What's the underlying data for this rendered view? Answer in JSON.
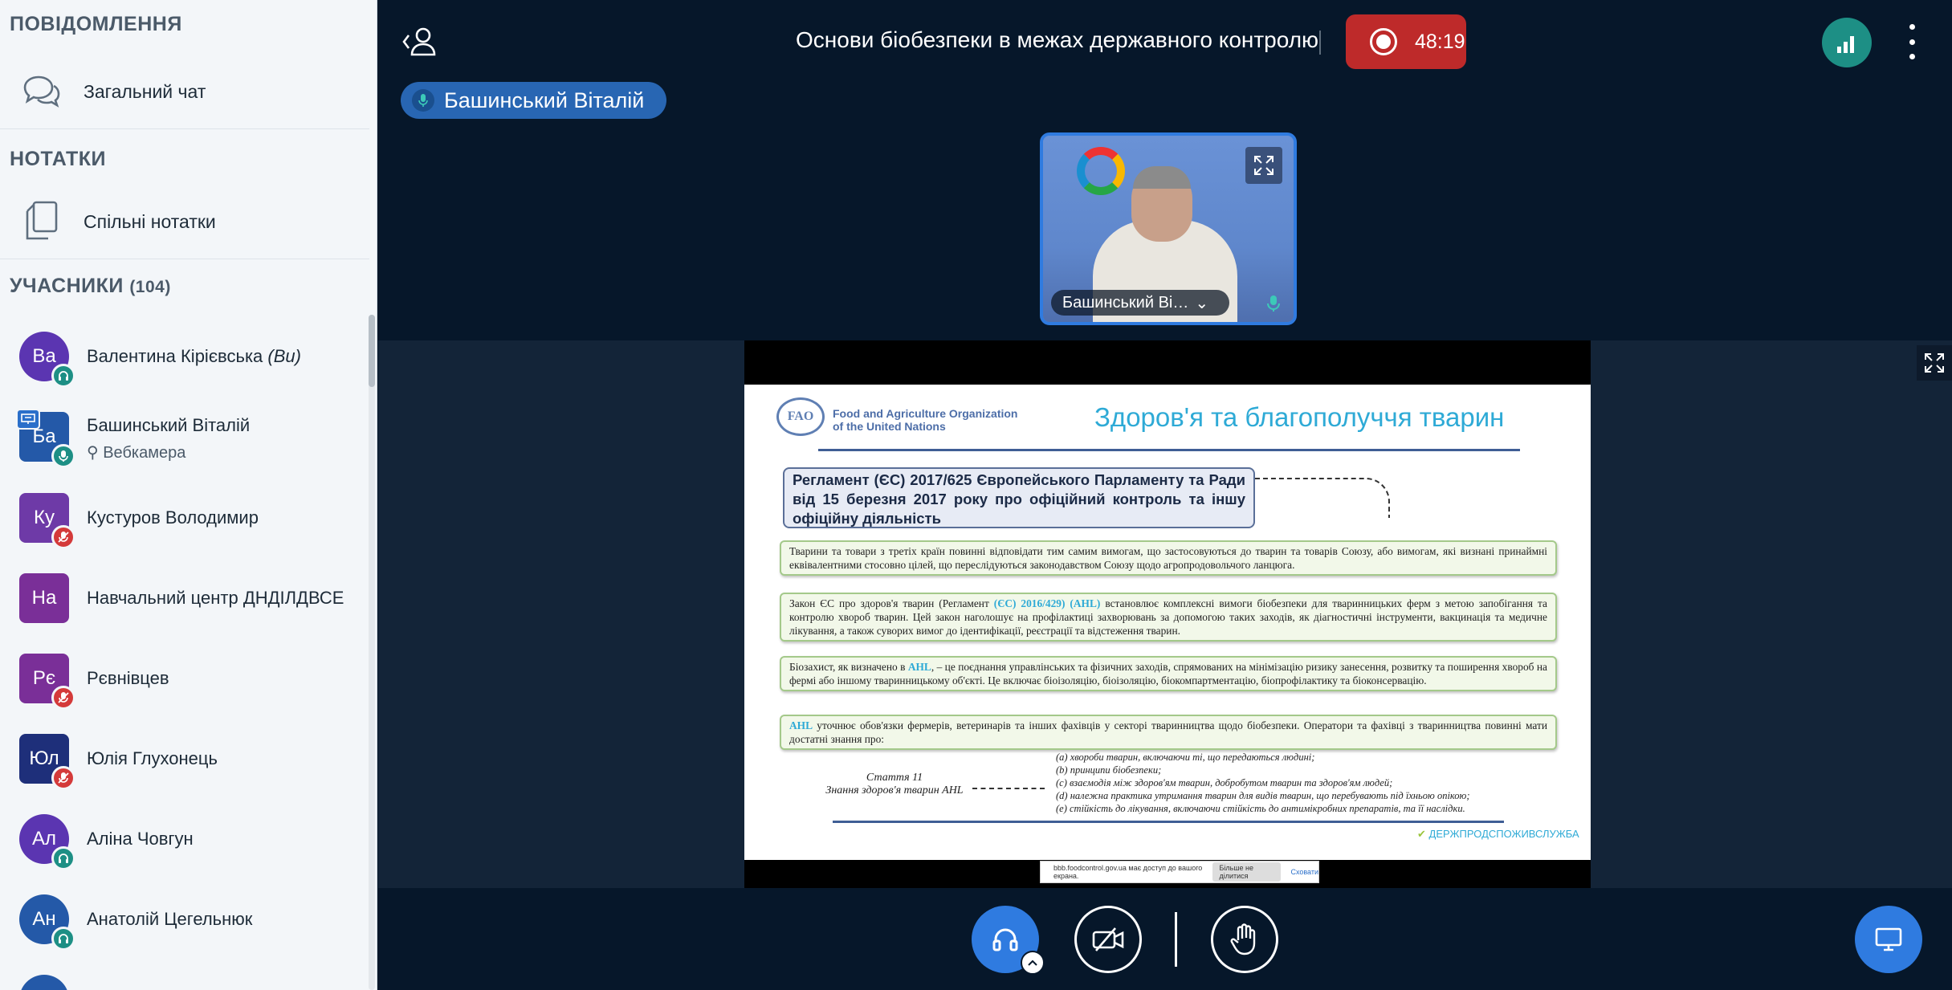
{
  "sidebar": {
    "messages_title": "ПОВІДОМЛЕННЯ",
    "public_chat": "Загальний чат",
    "notes_title": "НОТАТКИ",
    "shared_notes": "Спільні нотатки",
    "participants_title": "УЧАСНИКИ",
    "participants_count": "(104)",
    "users": [
      {
        "initials": "Ва",
        "name": "Валентина Кірієвська",
        "you_tag": "(Ви)",
        "color": "#5b35b1",
        "badge": "headset"
      },
      {
        "initials": "Ба",
        "name": "Башинський Віталій",
        "sub": "Вебкамера",
        "color": "#2459a8",
        "badge": "mic-on",
        "presenter": true
      },
      {
        "initials": "Ку",
        "name": "Кустуров Володимир",
        "color": "#6e3aa7",
        "badge": "mic-off"
      },
      {
        "initials": "На",
        "name": "Навчальний центр ДНДІЛДВСЕ",
        "color": "#7a2f98",
        "badge": "none"
      },
      {
        "initials": "Рє",
        "name": "Рєвнівцев",
        "color": "#7a2f98",
        "badge": "mic-off"
      },
      {
        "initials": "Юл",
        "name": "Юлія Глухонець",
        "color": "#1e2f7a",
        "badge": "mic-off"
      },
      {
        "initials": "Ал",
        "name": "Аліна Човгун",
        "color": "#5b35b1",
        "badge": "headset"
      },
      {
        "initials": "Ан",
        "name": "Анатолій Цегельнюк",
        "color": "#2459a8",
        "badge": "headset"
      }
    ]
  },
  "topbar": {
    "title": "Основи біобезпеки в межах державного контролю",
    "recording_time": "48:19"
  },
  "speaker": {
    "name": "Башинський Віталій"
  },
  "webcam": {
    "name": "Башинський Ві…"
  },
  "slide": {
    "org": [
      "Food and Agriculture Organization",
      "of the United Nations"
    ],
    "logo_text": "FAO",
    "title": "Здоров'я та благополуччя тварин",
    "regulation": "Регламент (ЄС) 2017/625 Європейського Парламенту та Ради від 15 березня 2017 року про офіційний контроль та іншу офіційну діяльність",
    "box1": "Тварини та товари з третіх країн повинні відповідати тим самим вимогам, що застосовуються до тварин та товарів Союзу, або вимогам, які визнані принаймні еквівалентними стосовно цілей, що переслідуються законодавством Союзу щодо агропродовольчого ланцюга.",
    "box2_pre": "Закон ЄС про здоров'я тварин (Регламент ",
    "box2_hl": "(ЄС) 2016/429) (AHL)",
    "box2_post": " встановлює комплексні вимоги біобезпеки для тваринницьких ферм з метою запобігання та контролю хвороб тварин. Цей закон наголошує на профілактиці захворювань за допомогою таких заходів, як діагностичні інструменти, вакцинація та медичне лікування, а також суворих вимог до ідентифікації, реєстрації та відстеження тварин.",
    "box3_pre": "Біозахист, як визначено в ",
    "box3_hl": "AHL",
    "box3_post": ", – це поєднання управлінських та фізичних заходів, спрямованих на мінімізацію ризику занесення, розвитку та поширення хвороб на фермі або іншому тваринницькому об'єкті. Це включає біоізоляцію, біоізоляцію, біокомпартментацію, біопрофілактику та біоконсервацію.",
    "box4_hl": "AHL",
    "box4_post": " уточнює обов'язки фермерів, ветеринарів та інших фахівців у секторі тваринництва щодо біобезпеки. Оператори та фахівці з тваринництва повинні мати достатні знання про:",
    "article": [
      "Стаття 11",
      "Знання здоров'я тварин AHL"
    ],
    "article_items": [
      "(a)  хвороби тварин, включаючи ті, що передаються людині;",
      "(b)  принципи біобезпеки;",
      "(c)  взаємодія між здоров'ям тварин, добробутом тварин та здоров'ям людей;",
      "(d)  належна практика утримання тварин для видів тварин, що перебувають під їхньою опікою;",
      "(e)  стійкість до лікування, включаючи стійкість до антимікробних препаратів, та її наслідки."
    ],
    "footer_brand": "ДЕРЖПРОДСПОЖИВСЛУЖБА",
    "notif_text": "bbb.foodcontrol.gov.ua має доступ до вашого екрана.",
    "notif_btn": "Більше не ділитися",
    "notif_link": "Сховати"
  },
  "colors": {
    "accent": "#2f7be0",
    "record": "#be2a2a",
    "connection": "#1d8f85",
    "headset_badge": "#1d8f85",
    "mic_on_badge": "#1d8f85",
    "mic_off_badge": "#d43a3a"
  }
}
